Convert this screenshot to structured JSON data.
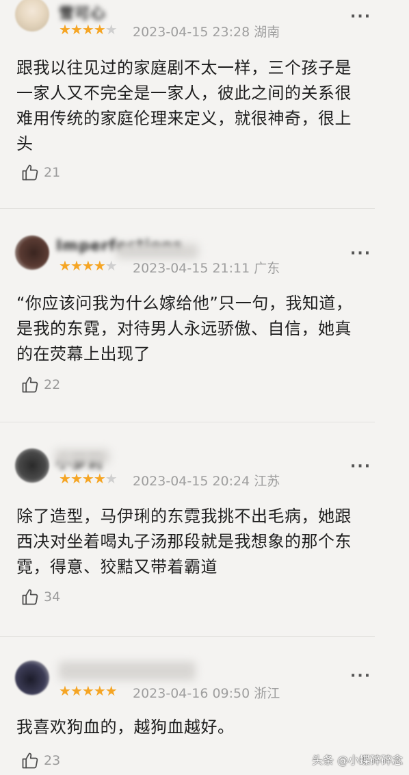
{
  "reviews": [
    {
      "username": "雪可心",
      "stars_filled": 4,
      "stars_total": 5,
      "date": "2023-04-15 23:28",
      "location": "湖南",
      "text": "跟我以往见过的家庭剧不太一样，三个孩子是一家人又不完全是一家人，彼此之间的关系很难用传统的家庭伦理来定义，就很神奇，很上头",
      "likes": "21"
    },
    {
      "username": "Imperfections",
      "stars_filled": 4,
      "stars_total": 5,
      "date": "2023-04-15 21:11",
      "location": "广东",
      "text": "“你应该问我为什么嫁给他”只一句，我知道，是我的东霓，对待男人永远骄傲、自信，她真的在荧幕上出现了",
      "likes": "22"
    },
    {
      "username": "小萝莉",
      "stars_filled": 4,
      "stars_total": 5,
      "date": "2023-04-15 20:24",
      "location": "江苏",
      "text": "除了造型，马伊琍的东霓我挑不出毛病，她跟西决对坐着喝丸子汤那段就是我想象的那个东霓，得意、狡黠又带着霸道",
      "likes": "34"
    },
    {
      "username": "",
      "stars_filled": 5,
      "stars_total": 5,
      "date": "2023-04-16 09:50",
      "location": "浙江",
      "text": "我喜欢狗血的，越狗血越好。",
      "likes": "23"
    }
  ],
  "more_icon": "more-dots-icon",
  "like_icon": "thumbs-up-icon",
  "colors": {
    "star": "#f5a524",
    "star_empty": "#cfcfcf",
    "meta": "#9e9e9e"
  },
  "watermark": "头条 @小蝶碎碎念"
}
